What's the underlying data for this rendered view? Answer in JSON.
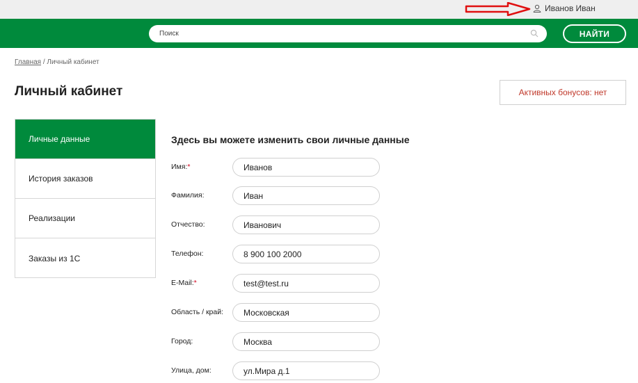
{
  "topbar": {
    "user_name": "Иванов Иван"
  },
  "header": {
    "search_placeholder": "Поиск",
    "find_label": "НАЙТИ"
  },
  "breadcrumb": {
    "home": "Главная",
    "separator": " / ",
    "current": "Личный кабинет"
  },
  "page": {
    "title": "Личный кабинет",
    "bonus": "Активных бонусов: нет"
  },
  "sidebar": {
    "items": [
      {
        "label": "Личные данные"
      },
      {
        "label": "История заказов"
      },
      {
        "label": "Реализации"
      },
      {
        "label": "Заказы из 1С"
      }
    ]
  },
  "form": {
    "heading": "Здесь вы можете изменить свои личные данные",
    "fields": [
      {
        "label": "Имя:",
        "required": "*",
        "value": "Иванов"
      },
      {
        "label": "Фамилия:",
        "required": "",
        "value": "Иван"
      },
      {
        "label": "Отчество:",
        "required": "",
        "value": "Иванович"
      },
      {
        "label": "Телефон:",
        "required": "",
        "value": "8 900 100 2000"
      },
      {
        "label": "E-Mail:",
        "required": "*",
        "value": "test@test.ru"
      },
      {
        "label": "Область / край:",
        "required": "",
        "value": "Московская"
      },
      {
        "label": "Город:",
        "required": "",
        "value": "Москва"
      },
      {
        "label": "Улица, дом:",
        "required": "",
        "value": "ул.Мира д.1"
      }
    ]
  },
  "colors": {
    "brand_green": "#008a3c",
    "bonus_red": "#c0392b",
    "required_red": "#d0021b",
    "annotation_arrow": "#e01010"
  },
  "icons": {
    "user": "user-icon",
    "search": "search-icon",
    "annotation": "red-arrow-annotation"
  }
}
